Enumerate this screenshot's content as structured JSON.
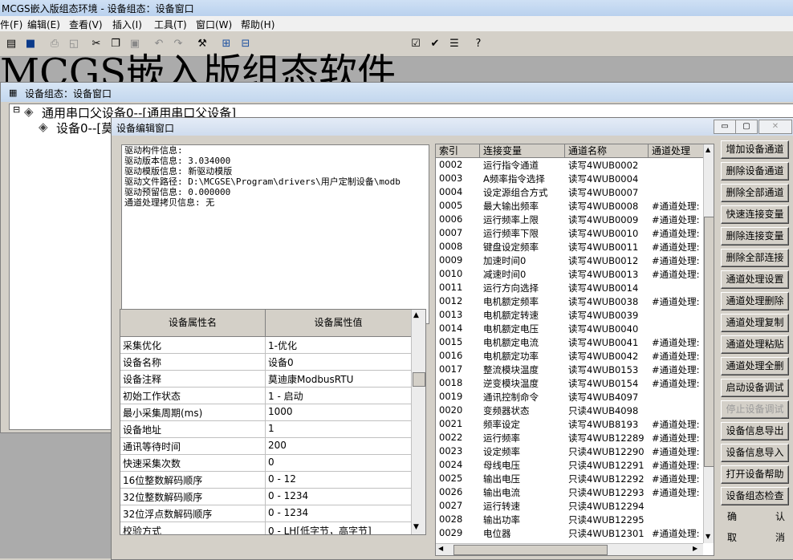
{
  "app": {
    "title": "MCGS嵌入版组态环境 - 设备组态：设备窗口",
    "menu": [
      "件(F)",
      "编辑(E)",
      "查看(V)",
      "插入(I)",
      "工具(T)",
      "窗口(W)",
      "帮助(H)"
    ],
    "background_title": "MCGS嵌入版组态软件"
  },
  "config_window": {
    "title": "设备组态：设备窗口",
    "tree": {
      "root": "通用串口父设备0--[通用串口父设备]",
      "child": "设备0--[莫迪康ModbusRTU]"
    }
  },
  "dialog": {
    "title": "设备编辑窗口",
    "window_buttons": [
      "▭",
      "▢",
      "✕"
    ],
    "driver_info": [
      "驱动构件信息:",
      "驱动版本信息: 3.034000",
      "驱动模版信息: 新驱动模版",
      "驱动文件路径: D:\\MCGSE\\Program\\drivers\\用户定制设备\\modb",
      "驱动预留信息: 0.000000",
      "通道处理拷贝信息: 无"
    ],
    "properties": {
      "headers": [
        "设备属性名",
        "设备属性值"
      ],
      "rows": [
        [
          "采集优化",
          "1-优化"
        ],
        [
          "设备名称",
          "设备0"
        ],
        [
          "设备注释",
          "莫迪康ModbusRTU"
        ],
        [
          "初始工作状态",
          "1 - 启动"
        ],
        [
          "最小采集周期(ms)",
          "1000"
        ],
        [
          "设备地址",
          "1"
        ],
        [
          "通讯等待时间",
          "200"
        ],
        [
          "快速采集次数",
          "0"
        ],
        [
          "16位整数解码顺序",
          "0 - 12"
        ],
        [
          "32位整数解码顺序",
          "0 - 1234"
        ],
        [
          "32位浮点数解码顺序",
          "0 - 1234"
        ],
        [
          "校验方式",
          "0 - LH[低字节，高字节]"
        ]
      ]
    },
    "channels": {
      "headers": [
        "索引",
        "连接变量",
        "通道名称",
        "通道处理"
      ],
      "rows": [
        [
          "0002",
          "运行指令通道",
          "读写4WUB0002",
          ""
        ],
        [
          "0003",
          "A频率指令选择",
          "读写4WUB0004",
          ""
        ],
        [
          "0004",
          "设定源组合方式",
          "读写4WUB0007",
          ""
        ],
        [
          "0005",
          "最大输出频率",
          "读写4WUB0008",
          "#通道处理:"
        ],
        [
          "0006",
          "运行频率上限",
          "读写4WUB0009",
          "#通道处理:"
        ],
        [
          "0007",
          "运行频率下限",
          "读写4WUB0010",
          "#通道处理:"
        ],
        [
          "0008",
          "键盘设定频率",
          "读写4WUB0011",
          "#通道处理:"
        ],
        [
          "0009",
          "加速时间0",
          "读写4WUB0012",
          "#通道处理:"
        ],
        [
          "0010",
          "减速时间0",
          "读写4WUB0013",
          "#通道处理:"
        ],
        [
          "0011",
          "运行方向选择",
          "读写4WUB0014",
          ""
        ],
        [
          "0012",
          "电机额定频率",
          "读写4WUB0038",
          "#通道处理:"
        ],
        [
          "0013",
          "电机额定转速",
          "读写4WUB0039",
          ""
        ],
        [
          "0014",
          "电机额定电压",
          "读写4WUB0040",
          ""
        ],
        [
          "0015",
          "电机额定电流",
          "读写4WUB0041",
          "#通道处理:"
        ],
        [
          "0016",
          "电机额定功率",
          "读写4WUB0042",
          "#通道处理:"
        ],
        [
          "0017",
          "整流模块温度",
          "读写4WUB0153",
          "#通道处理:"
        ],
        [
          "0018",
          "逆变模块温度",
          "读写4WUB0154",
          "#通道处理:"
        ],
        [
          "0019",
          "通讯控制命令",
          "读写4WUB4097",
          ""
        ],
        [
          "0020",
          "变频器状态",
          "只读4WUB4098",
          ""
        ],
        [
          "0021",
          "频率设定",
          "读写4WUB8193",
          "#通道处理:"
        ],
        [
          "0022",
          "运行频率",
          "读写4WUB12289",
          "#通道处理:"
        ],
        [
          "0023",
          "设定频率",
          "只读4WUB12290",
          "#通道处理:"
        ],
        [
          "0024",
          "母线电压",
          "只读4WUB12291",
          "#通道处理:"
        ],
        [
          "0025",
          "输出电压",
          "只读4WUB12292",
          "#通道处理:"
        ],
        [
          "0026",
          "输出电流",
          "只读4WUB12293",
          "#通道处理:"
        ],
        [
          "0027",
          "运行转速",
          "只读4WUB12294",
          ""
        ],
        [
          "0028",
          "输出功率",
          "只读4WUB12295",
          ""
        ],
        [
          "0029",
          "电位器",
          "只读4WUB12301",
          "#通道处理:"
        ]
      ]
    },
    "buttons": [
      {
        "label": "增加设备通道",
        "enabled": true
      },
      {
        "label": "删除设备通道",
        "enabled": true
      },
      {
        "label": "删除全部通道",
        "enabled": true
      },
      {
        "label": "快速连接变量",
        "enabled": true
      },
      {
        "label": "删除连接变量",
        "enabled": true
      },
      {
        "label": "删除全部连接",
        "enabled": true
      },
      {
        "label": "通道处理设置",
        "enabled": true
      },
      {
        "label": "通道处理删除",
        "enabled": true
      },
      {
        "label": "通道处理复制",
        "enabled": true
      },
      {
        "label": "通道处理粘贴",
        "enabled": true
      },
      {
        "label": "通道处理全删",
        "enabled": true
      },
      {
        "label": "启动设备调试",
        "enabled": true
      },
      {
        "label": "停止设备调试",
        "enabled": false
      },
      {
        "label": "设备信息导出",
        "enabled": true
      },
      {
        "label": "设备信息导入",
        "enabled": true
      },
      {
        "label": "打开设备帮助",
        "enabled": true
      },
      {
        "label": "设备组态检查",
        "enabled": true
      }
    ],
    "ok": [
      "确",
      "认"
    ],
    "cancel": [
      "取",
      "消"
    ]
  }
}
